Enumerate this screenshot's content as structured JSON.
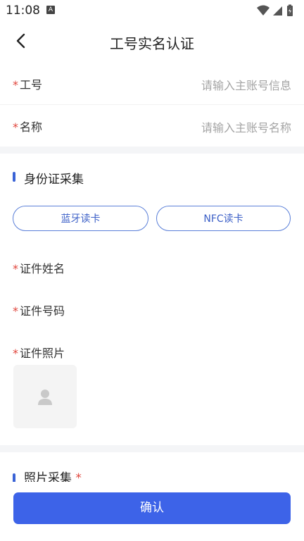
{
  "status_bar": {
    "time": "11:08",
    "notification_badge": "A"
  },
  "header": {
    "title": "工号实名认证"
  },
  "form": {
    "required_mark": "*",
    "job_id": {
      "label": "工号",
      "placeholder": "请输入主账号信息"
    },
    "name": {
      "label": "名称",
      "placeholder": "请输入主账号名称"
    }
  },
  "id_section": {
    "title": "身份证采集",
    "bluetooth_button": "蓝牙读卡",
    "nfc_button": "NFC读卡",
    "fields": {
      "id_name": "证件姓名",
      "id_number": "证件号码",
      "id_photo": "证件照片"
    }
  },
  "photo_section": {
    "title": "照片采集"
  },
  "footer": {
    "confirm_label": "确认"
  },
  "colors": {
    "accent": "#3d63e8",
    "required": "#e0453c"
  },
  "icons": [
    "back-arrow-icon",
    "wifi-icon",
    "signal-icon",
    "battery-icon",
    "person-placeholder-icon"
  ]
}
